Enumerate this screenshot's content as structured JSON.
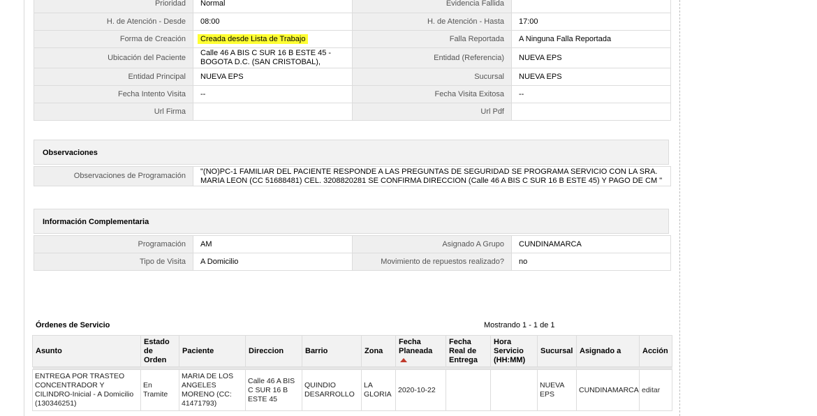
{
  "details": {
    "rows": [
      {
        "l1": "Prioridad",
        "v1": "Normal",
        "l2": "Evidencia Fallida",
        "v2": ""
      },
      {
        "l1": "H. de Atención - Desde",
        "v1": "08:00",
        "l2": "H. de Atención - Hasta",
        "v2": "17:00"
      },
      {
        "l1": "Forma de Creación",
        "v1": "Creada desde Lista de Trabajo",
        "l2": "Falla Reportada",
        "v2": "A Ninguna Falla Reportada"
      },
      {
        "l1": "Ubicación del Paciente",
        "v1": "Calle 46 A BIS C SUR 16 B ESTE 45 - BOGOTA D.C. (SAN CRISTOBAL),",
        "l2": "Entidad (Referencia)",
        "v2": "NUEVA EPS"
      },
      {
        "l1": "Entidad Principal",
        "v1": "NUEVA EPS",
        "l2": "Sucursal",
        "v2": "NUEVA EPS"
      },
      {
        "l1": "Fecha Intento Visita",
        "v1": "--",
        "l2": "Fecha Visita Exitosa",
        "v2": "--"
      },
      {
        "l1": "Url Firma",
        "v1": "",
        "l2": "Url Pdf",
        "v2": ""
      }
    ]
  },
  "observaciones": {
    "title": "Observaciones",
    "label": "Observaciones de Programación",
    "value": "\"(NO)PC-1 FAMILIAR DEL PACIENTE RESPONDE A LAS PREGUNTAS DE SEGURIDAD SE PROGRAMA SERVICIO CON LA SRA. MARIA LEON (CC 51688481) CEL. 3208820281 SE CONFIRMA DIRECCION (Calle 46 A BIS C SUR 16 B ESTE 45) Y PAGO DE CM \""
  },
  "complementaria": {
    "title": "Información Complementaria",
    "rows": [
      {
        "l1": "Programación",
        "v1": "AM",
        "l2": "Asignado A Grupo",
        "v2": "CUNDINAMARCA"
      },
      {
        "l1": "Tipo de Visita",
        "v1": "A Domicilio",
        "l2": "Movimiento de repuestos realizado?",
        "v2": "no"
      }
    ]
  },
  "orders": {
    "title": "Órdenes de Servicio",
    "count": "Mostrando 1 - 1 de 1",
    "headers": [
      "Asunto",
      "Estado de Orden",
      "Paciente",
      "Direccion",
      "Barrio",
      "Zona",
      "Fecha Planeada",
      "Fecha Real de Entrega",
      "Hora Servicio (HH:MM)",
      "Sucursal",
      "Asignado a",
      "Acción"
    ],
    "rows": [
      [
        "ENTREGA POR TRASTEO CONCENTRADOR Y CILINDRO-Inicial - A Domicilio (130346251)",
        "En Tramite",
        "MARIA DE LOS ANGELES MORENO (CC: 41471793)",
        "Calle 46 A BIS C SUR 16 B ESTE 45",
        "QUINDIO DESARROLLO",
        "LA GLORIA",
        "2020-10-22",
        "",
        "",
        "NUEVA EPS",
        "CUNDINAMARCA",
        "editar"
      ]
    ]
  },
  "colors": {
    "highlight": "#ffff33",
    "label_bg": "#efefef",
    "sort_arrow": "#c0392b"
  }
}
